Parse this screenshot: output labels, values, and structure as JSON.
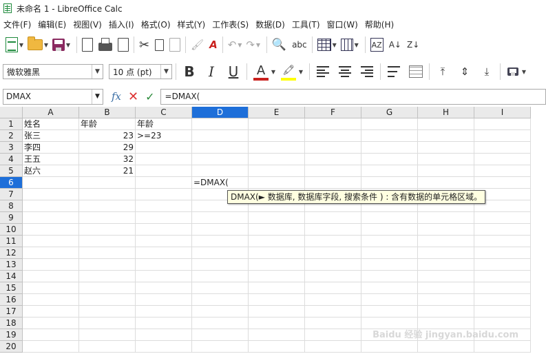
{
  "window": {
    "title": "未命名 1 - LibreOffice Calc"
  },
  "menu": [
    "文件(F)",
    "编辑(E)",
    "视图(V)",
    "插入(I)",
    "格式(O)",
    "样式(Y)",
    "工作表(S)",
    "数据(D)",
    "工具(T)",
    "窗口(W)",
    "帮助(H)"
  ],
  "toolbar": {
    "font_name": "微软雅黑",
    "font_size": "10 点 (pt)",
    "bold_label": "B",
    "italic_label": "I",
    "underline_label": "U",
    "fontcolor_label": "A",
    "spelling_label": "abc",
    "sort_label": "AZ",
    "sort_asc_label": "A↓",
    "sort_desc_label": "Z↓"
  },
  "formula_bar": {
    "name_box": "DMAX",
    "fx_label": "fx",
    "cancel_label": "✕",
    "accept_label": "✓",
    "formula": "=DMAX("
  },
  "sheet": {
    "columns": [
      "A",
      "B",
      "C",
      "D",
      "E",
      "F",
      "G",
      "H",
      "I"
    ],
    "active_column": "D",
    "active_row": 6,
    "rows": [
      {
        "n": "1",
        "cells": [
          "姓名",
          "年龄",
          "年龄",
          "",
          "",
          "",
          "",
          "",
          ""
        ]
      },
      {
        "n": "2",
        "cells": [
          "张三",
          "23",
          ">=23",
          "",
          "",
          "",
          "",
          "",
          ""
        ]
      },
      {
        "n": "3",
        "cells": [
          "李四",
          "29",
          "",
          "",
          "",
          "",
          "",
          "",
          ""
        ]
      },
      {
        "n": "4",
        "cells": [
          "王五",
          "32",
          "",
          "",
          "",
          "",
          "",
          "",
          ""
        ]
      },
      {
        "n": "5",
        "cells": [
          "赵六",
          "21",
          "",
          "",
          "",
          "",
          "",
          "",
          ""
        ]
      },
      {
        "n": "6",
        "cells": [
          "",
          "",
          "",
          "=DMAX(",
          "",
          "",
          "",
          "",
          ""
        ]
      },
      {
        "n": "7",
        "cells": [
          "",
          "",
          "",
          "",
          "",
          "",
          "",
          "",
          ""
        ]
      },
      {
        "n": "8",
        "cells": [
          "",
          "",
          "",
          "",
          "",
          "",
          "",
          "",
          ""
        ]
      },
      {
        "n": "9",
        "cells": [
          "",
          "",
          "",
          "",
          "",
          "",
          "",
          "",
          ""
        ]
      },
      {
        "n": "10",
        "cells": [
          "",
          "",
          "",
          "",
          "",
          "",
          "",
          "",
          ""
        ]
      },
      {
        "n": "11",
        "cells": [
          "",
          "",
          "",
          "",
          "",
          "",
          "",
          "",
          ""
        ]
      },
      {
        "n": "12",
        "cells": [
          "",
          "",
          "",
          "",
          "",
          "",
          "",
          "",
          ""
        ]
      },
      {
        "n": "13",
        "cells": [
          "",
          "",
          "",
          "",
          "",
          "",
          "",
          "",
          ""
        ]
      },
      {
        "n": "14",
        "cells": [
          "",
          "",
          "",
          "",
          "",
          "",
          "",
          "",
          ""
        ]
      },
      {
        "n": "15",
        "cells": [
          "",
          "",
          "",
          "",
          "",
          "",
          "",
          "",
          ""
        ]
      },
      {
        "n": "16",
        "cells": [
          "",
          "",
          "",
          "",
          "",
          "",
          "",
          "",
          ""
        ]
      },
      {
        "n": "17",
        "cells": [
          "",
          "",
          "",
          "",
          "",
          "",
          "",
          "",
          ""
        ]
      },
      {
        "n": "18",
        "cells": [
          "",
          "",
          "",
          "",
          "",
          "",
          "",
          "",
          ""
        ]
      },
      {
        "n": "19",
        "cells": [
          "",
          "",
          "",
          "",
          "",
          "",
          "",
          "",
          ""
        ]
      },
      {
        "n": "20",
        "cells": [
          "",
          "",
          "",
          "",
          "",
          "",
          "",
          "",
          ""
        ]
      }
    ]
  },
  "tooltip": "DMAX(► 数据库, 数据库字段, 搜索条件 ) : 含有数据的单元格区域。",
  "watermark": "Baidu 经验 jingyan.baidu.com",
  "colors": {
    "active_header": "#1e6fd9",
    "tooltip_bg": "#ffffe1",
    "font_color": "#c9211e",
    "highlight": "#ffff00"
  }
}
